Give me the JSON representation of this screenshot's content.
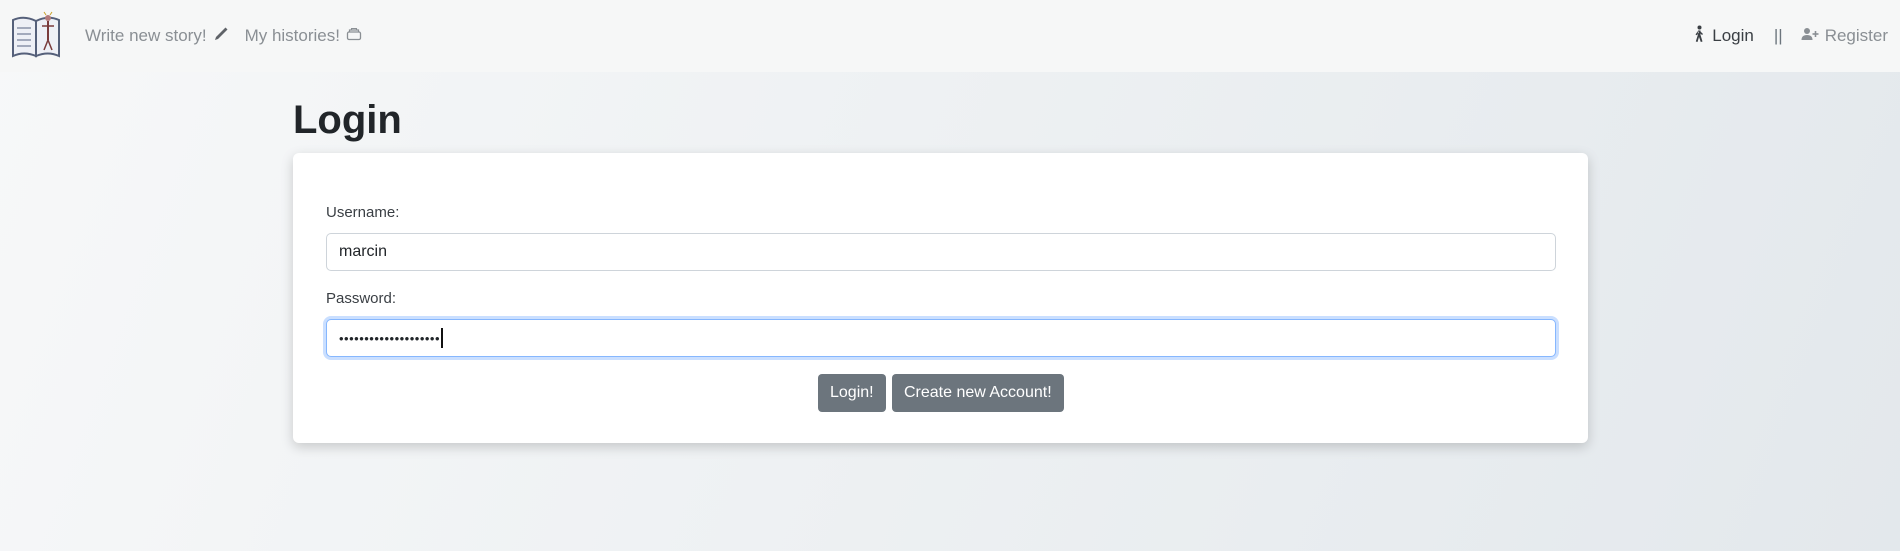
{
  "navbar": {
    "logo_icon": "open-book-logo-icon",
    "write_story_label": "Write new story!",
    "write_story_icon": "pencil-icon",
    "my_histories_label": "My histories!",
    "my_histories_icon": "stack-icon",
    "login_label": "Login",
    "login_icon": "walking-person-icon",
    "separator": "||",
    "register_label": "Register",
    "register_icon": "person-add-icon"
  },
  "page": {
    "title": "Login"
  },
  "form": {
    "username_label": "Username:",
    "username_value": "marcin",
    "password_label": "Password:",
    "password_value": "••••••••••••••••••••",
    "login_button": "Login!",
    "create_account_button": "Create new Account!"
  },
  "colors": {
    "button_bg": "#6c757d",
    "focus_border": "#86b7fe",
    "nav_text": "#8a8f94"
  }
}
